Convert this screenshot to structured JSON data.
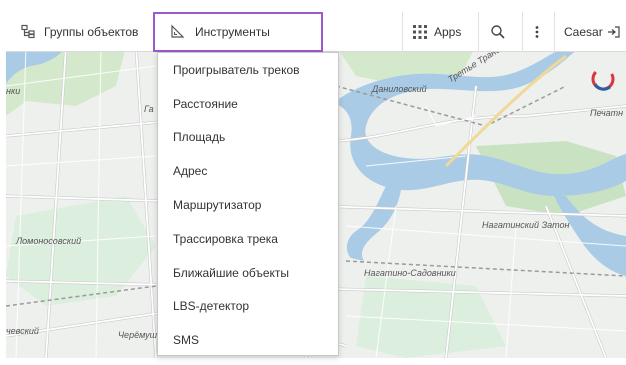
{
  "toolbar": {
    "groups_label": "Группы объектов",
    "tools_label": "Инструменты",
    "apps_label": "Apps",
    "user_label": "Caesar",
    "colors": {
      "accent_border": "#9b59d0"
    }
  },
  "tools_menu": {
    "items": [
      "Проигрыватель треков",
      "Расстояние",
      "Площадь",
      "Адрес",
      "Маршрутизатор",
      "Трассировка трека",
      "Ближайшие объекты",
      "LBS-детектор",
      "SMS"
    ]
  },
  "map": {
    "labels": {
      "danilovsky": "Даниловский",
      "third_ring": "Третье Транспор",
      "pechat": "Печатн",
      "lomonosovsky": "Ломоносовский",
      "nagatinsky_zaton": "Нагатинский Затон",
      "nagatino_sadovniki": "Нагатино-Садовники",
      "cheremushki": "Черёмуш",
      "vernadsky_left": "чевский",
      "nki": "нки",
      "ga": "Га"
    },
    "colors": {
      "water": "#a9cbe6",
      "park": "#c9e3c2",
      "road": "#ffffff",
      "road_major": "#f7f7f7",
      "road_outline": "#c9c9c9",
      "rail": "#9a9a9a"
    }
  }
}
